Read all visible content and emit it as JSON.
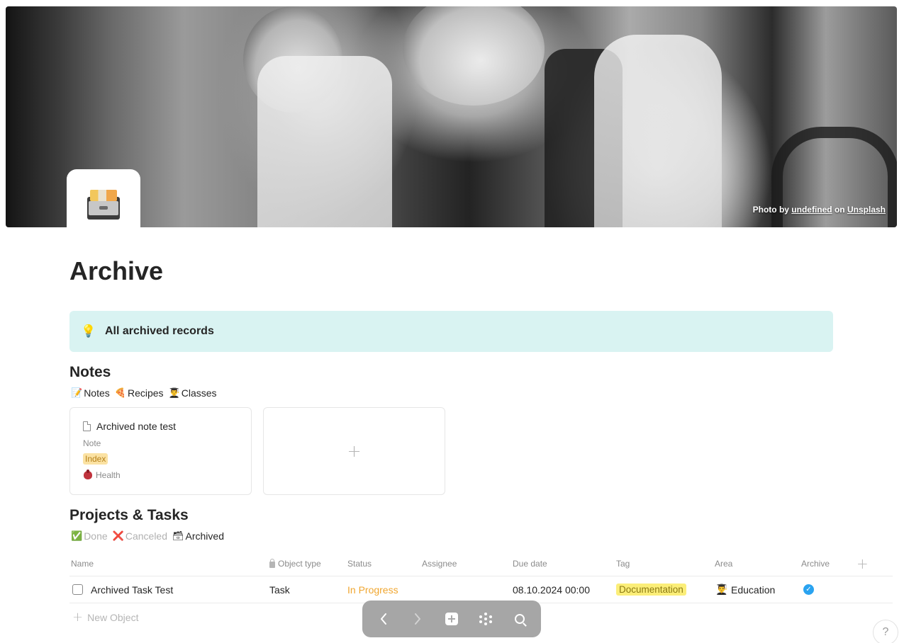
{
  "cover": {
    "credit_prefix": "Photo by",
    "credit_author": "undefined",
    "credit_on": "on",
    "credit_source": "Unsplash"
  },
  "page": {
    "icon": "card-file-box-icon",
    "title": "Archive"
  },
  "callout": {
    "icon": "light-bulb-icon",
    "text": "All archived records"
  },
  "notes_section": {
    "title": "Notes",
    "views": [
      {
        "icon": "memo-icon",
        "glyph": "📝",
        "label": "Notes"
      },
      {
        "icon": "pizza-icon",
        "glyph": "🍕",
        "label": "Recipes"
      },
      {
        "icon": "student-icon",
        "glyph": "👨‍🎓",
        "label": "Classes"
      }
    ],
    "cards": [
      {
        "title": "Archived note test",
        "type": "Note",
        "tag": "Index",
        "area": "Health"
      }
    ],
    "add_card_label": "+"
  },
  "projects_section": {
    "title": "Projects & Tasks",
    "views": [
      {
        "icon": "check-box-icon",
        "glyph": "✅",
        "label": "Done"
      },
      {
        "icon": "cross-mark-icon",
        "glyph": "❌",
        "label": "Canceled"
      },
      {
        "icon": "archive-box-icon",
        "glyph": "🗃",
        "label": "Archived"
      }
    ],
    "columns": [
      "Name",
      "Object type",
      "Status",
      "Assignee",
      "Due date",
      "Tag",
      "Area",
      "Archive"
    ],
    "rows": [
      {
        "name": "Archived Task Test",
        "object_type": "Task",
        "status": "In Progress",
        "assignee": "",
        "due_date": "08.10.2024 00:00",
        "tag": "Documentation",
        "area": "Education",
        "archive": true
      }
    ],
    "new_object_label": "New Object"
  },
  "colors": {
    "callout_bg": "#d9f3f2",
    "status_in_progress": "#f0a62f",
    "tag_index_bg": "#fbe2a3",
    "tag_documentation_bg": "#fbee79",
    "archive_check": "#2aa3f0",
    "navbar_bg": "#a6a6a6"
  },
  "navbar": {
    "items": [
      "back-icon",
      "forward-icon",
      "add-icon",
      "graph-icon",
      "search-icon"
    ]
  },
  "help": {
    "label": "?"
  }
}
